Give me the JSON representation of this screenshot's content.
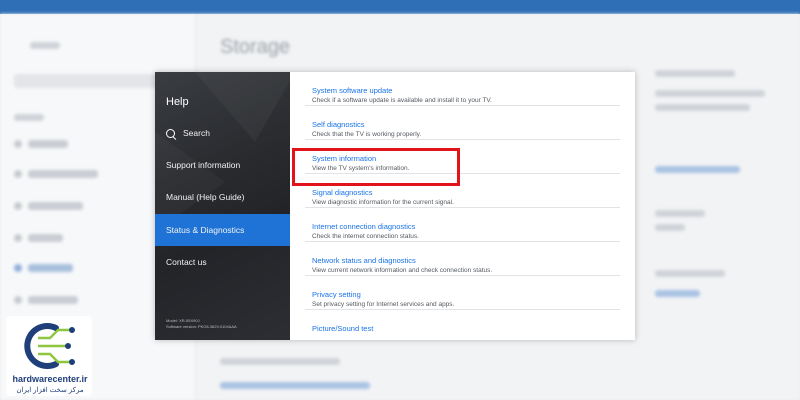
{
  "background_page": {
    "title": "Storage"
  },
  "help_panel": {
    "title": "Help",
    "menu": [
      {
        "label": "Search",
        "icon": "search-icon"
      },
      {
        "label": "Support information"
      },
      {
        "label": "Manual (Help Guide)"
      },
      {
        "label": "Status & Diagnostics",
        "active": true
      },
      {
        "label": "Contact us"
      }
    ],
    "model_line": "Model: XR-55X90J",
    "software_line": "Software version: PKG6.3629.0104AAA"
  },
  "entries": [
    {
      "title": "System software update",
      "description": "Check if a software update is available and install it to your TV."
    },
    {
      "title": "Self diagnostics",
      "description": "Check that the TV is working properly."
    },
    {
      "title": "System information",
      "description": "View the TV system's information.",
      "highlighted": true
    },
    {
      "title": "Signal diagnostics",
      "description": "View diagnostic information for the current signal."
    },
    {
      "title": "Internet connection diagnostics",
      "description": "Check the internet connection status."
    },
    {
      "title": "Network status and diagnostics",
      "description": "View current network information and check connection status."
    },
    {
      "title": "Privacy setting",
      "description": "Set privacy setting for Internet services and apps."
    },
    {
      "title": "Picture/Sound test",
      "description": ""
    }
  ],
  "logo": {
    "brand": "hardwarecenter.ir",
    "subtitle": "مرکز سخت افزار ایران"
  },
  "colors": {
    "accent": "#1f73d6",
    "link": "#1a73e8",
    "highlight_box": "#e3131b"
  }
}
